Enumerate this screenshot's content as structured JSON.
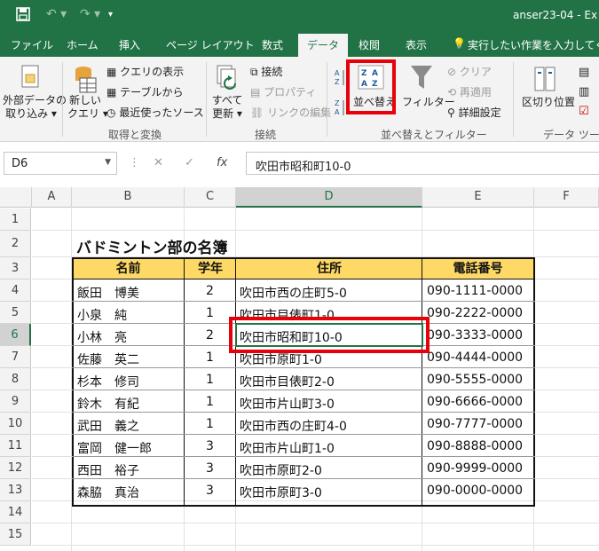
{
  "window": {
    "title": "anser23-04 - Ex"
  },
  "tabs": [
    "ファイル",
    "ホーム",
    "挿入",
    "ページ レイアウト",
    "数式",
    "データ",
    "校閲",
    "表示"
  ],
  "tell_me": "実行したい作業を入力してくださ",
  "ribbon": {
    "get_external": [
      "外部データの",
      "取り込み ▾"
    ],
    "new_query": [
      "新しい",
      "クエリ ▾"
    ],
    "show_queries": "クエリの表示",
    "from_table": "テーブルから",
    "recent_sources": "最近使ったソース",
    "refresh_all": [
      "すべて",
      "更新 ▾"
    ],
    "connections": "接続",
    "properties": "プロパティ",
    "edit_links": "リンクの編集",
    "sort": "並べ替え",
    "filter": "フィルター",
    "clear": "クリア",
    "reapply": "再適用",
    "advanced": "詳細設定",
    "text_to_columns": "区切り位置",
    "group_get_transform": "取得と変換",
    "group_connections": "接続",
    "group_sort_filter": "並べ替えとフィルター",
    "group_data_tools": "データ ツール"
  },
  "formula_bar": {
    "name_box": "D6",
    "fx": "fx",
    "value": "吹田市昭和町10-0"
  },
  "columns": [
    "A",
    "B",
    "C",
    "D",
    "E",
    "F"
  ],
  "rows": [
    "1",
    "2",
    "3",
    "4",
    "5",
    "6",
    "7",
    "8",
    "9",
    "10",
    "11",
    "12",
    "13",
    "14",
    "15"
  ],
  "sheet": {
    "title": "バドミントン部の名簿",
    "headers": [
      "名前",
      "学年",
      "住所",
      "電話番号"
    ],
    "records": [
      [
        "飯田　博美",
        "2",
        "吹田市西の庄町5-0",
        "090-1111-0000"
      ],
      [
        "小泉　純",
        "1",
        "吹田市目俵町1-0",
        "090-2222-0000"
      ],
      [
        "小林　亮",
        "2",
        "吹田市昭和町10-0",
        "090-3333-0000"
      ],
      [
        "佐藤　英二",
        "1",
        "吹田市原町1-0",
        "090-4444-0000"
      ],
      [
        "杉本　修司",
        "1",
        "吹田市目俵町2-0",
        "090-5555-0000"
      ],
      [
        "鈴木　有紀",
        "1",
        "吹田市片山町3-0",
        "090-6666-0000"
      ],
      [
        "武田　義之",
        "1",
        "吹田市西の庄町4-0",
        "090-7777-0000"
      ],
      [
        "富岡　健一郎",
        "3",
        "吹田市片山町1-0",
        "090-8888-0000"
      ],
      [
        "西田　裕子",
        "3",
        "吹田市原町2-0",
        "090-9999-0000"
      ],
      [
        "森脇　真治",
        "3",
        "吹田市原町3-0",
        "090-0000-0000"
      ]
    ]
  },
  "colors": {
    "excel_green": "#217346",
    "header_fill": "#ffd966",
    "highlight_red": "#e8000b"
  }
}
